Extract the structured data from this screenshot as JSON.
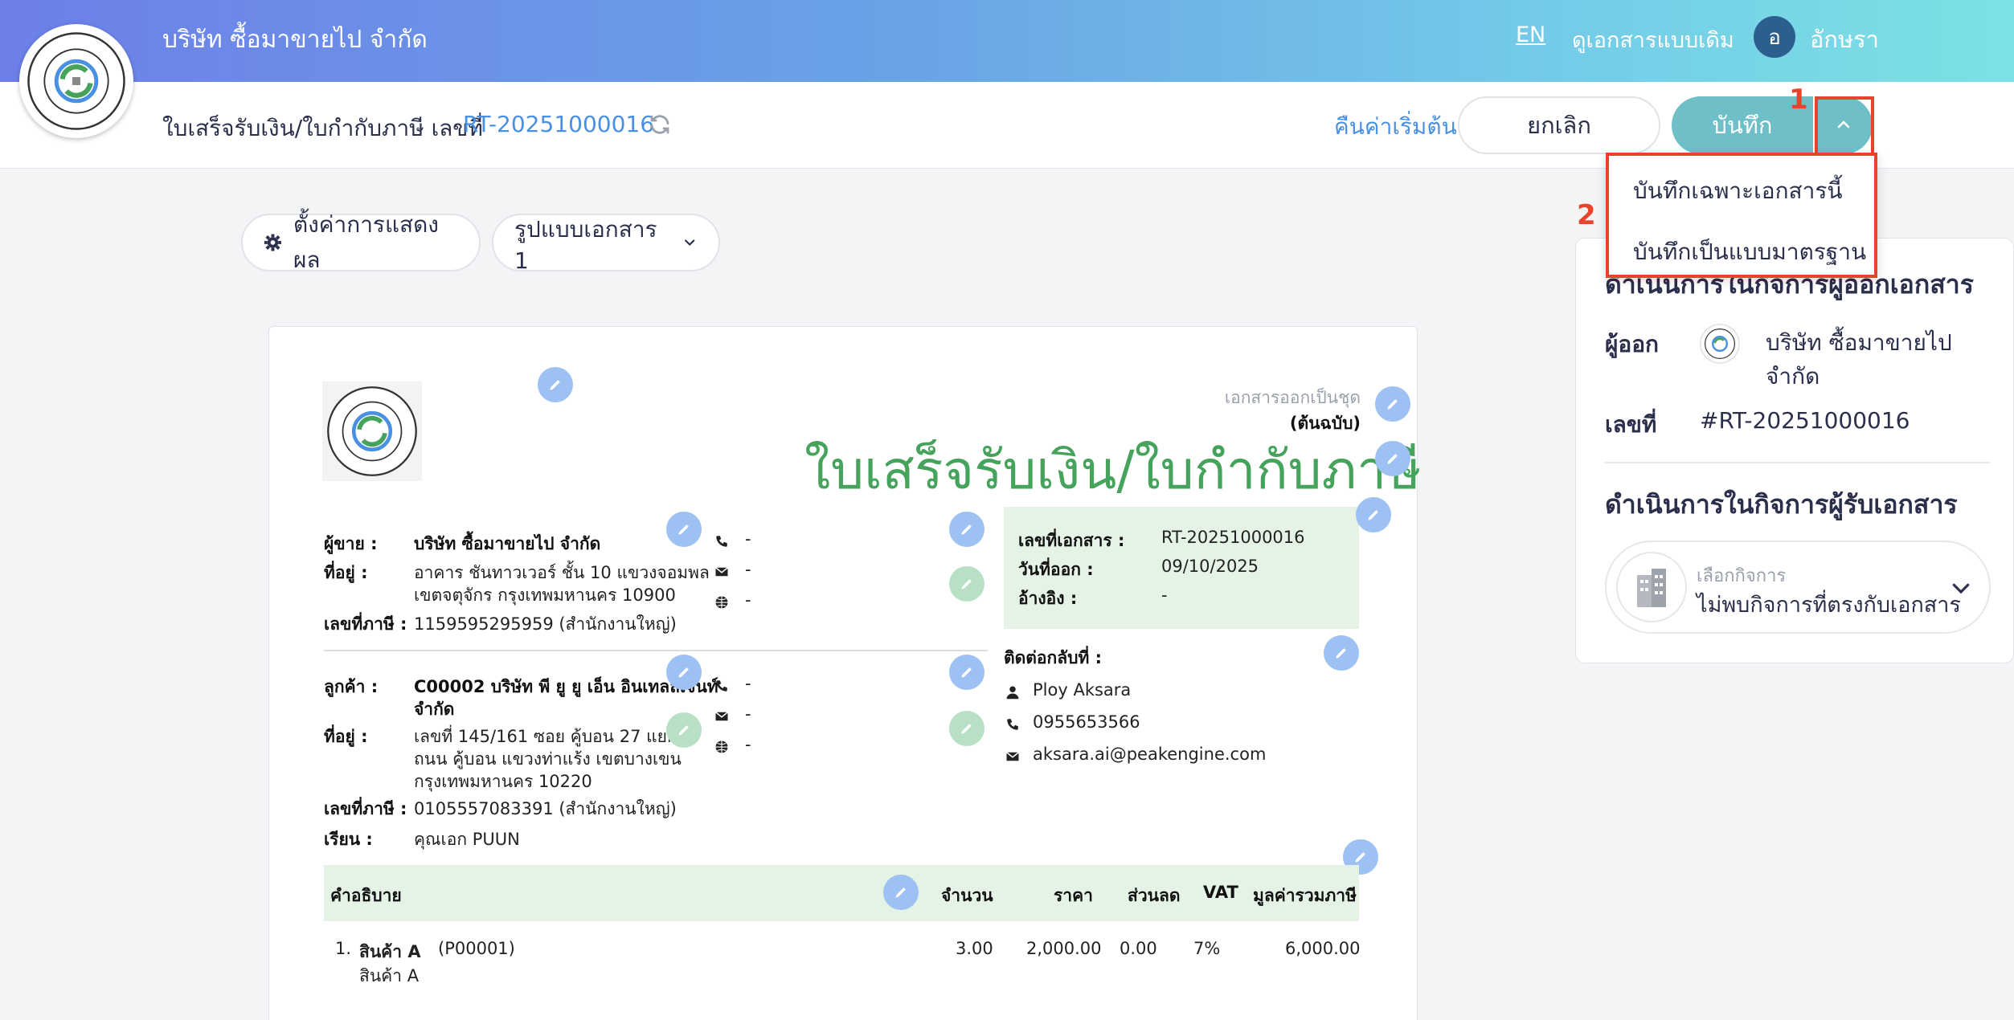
{
  "header": {
    "company_name": "บริษัท ซื้อมาขายไป จำกัด",
    "lang": "EN",
    "old_doc_view": "ดูเอกสารแบบเดิม",
    "avatar_initial": "อ",
    "user_name": "อักษรา"
  },
  "subheader": {
    "doc_type": "ใบเสร็จรับเงิน/ใบกำกับภาษี เลขที่",
    "doc_number": "RT-20251000016",
    "reset_label": "คืนค่าเริ่มต้น",
    "cancel_label": "ยกเลิก",
    "save_label": "บันทึก"
  },
  "save_menu": {
    "items": [
      "บันทึกเฉพาะเอกสารนี้",
      "บันทึกเป็นแบบมาตรฐาน"
    ]
  },
  "annotations": {
    "one": "1",
    "two": "2"
  },
  "toolbar": {
    "display_settings": "ตั้งค่าการแสดงผล",
    "template": "รูปแบบเอกสาร 1"
  },
  "document": {
    "issued_as_set": "เอกสารออกเป็นชุด",
    "original": "(ต้นฉบับ)",
    "title": "ใบเสร็จรับเงิน/ใบกำกับภาษี",
    "seller": {
      "label": "ผู้ขาย :",
      "name": "บริษัท ซื้อมาขายไป จำกัด",
      "address_label": "ที่อยู่ :",
      "address_1": "อาคาร ชันทาวเวอร์ ชั้น 10 แขวงจอมพล",
      "address_2": "เขตจตุจักร กรุงเทพมหานคร 10900",
      "tax_label": "เลขที่ภาษี :",
      "tax_id": "1159595295959 (สำนักงานใหญ่)",
      "phone": "-",
      "email": "-",
      "web": "-"
    },
    "customer": {
      "label": "ลูกค้า :",
      "name_1": "C00002 บริษัท พี ยู ยู เอ็น อินเทลลิเจนท์",
      "name_2": "จำกัด",
      "address_label": "ที่อยู่ :",
      "address_1": "เลขที่ 145/161    ซอย คู้บอน 27 แยก 7",
      "address_2": "ถนน คู้บอน  แขวงท่าแร้ง เขตบางเขน",
      "address_3": "กรุงเทพมหานคร 10220",
      "tax_label": "เลขที่ภาษี :",
      "tax_id": "0105557083391 (สำนักงานใหญ่)",
      "attn_label": "เรียน :",
      "attn": "คุณเอก PUUN",
      "phone": "-",
      "email": "-",
      "web": "-"
    },
    "info": {
      "doc_no_label": "เลขที่เอกสาร :",
      "doc_no": "RT-20251000016",
      "date_label": "วันที่ออก :",
      "date": "09/10/2025",
      "ref_label": "อ้างอิง :",
      "ref": "-"
    },
    "contact": {
      "label": "ติดต่อกลับที่ :",
      "name": "Ploy Aksara",
      "phone": "0955653566",
      "email": "aksara.ai@peakengine.com"
    },
    "table": {
      "headers": [
        "คำอธิบาย",
        "จำนวน",
        "ราคา",
        "ส่วนลด",
        "VAT",
        "มูลค่ารวมภาษี"
      ],
      "rows": [
        {
          "no": "1.",
          "name": "สินค้า A",
          "code": "(P00001)",
          "desc": "สินค้า A",
          "qty": "3.00",
          "price": "2,000.00",
          "discount": "0.00",
          "vat": "7%",
          "total": "6,000.00"
        }
      ]
    }
  },
  "right_panel": {
    "issuer_heading": "ดำเนินการในกิจการผู้ออกเอกสาร",
    "issuer_label": "ผู้ออก",
    "issuer_name_1": "บริษัท ซื้อมาขายไป",
    "issuer_name_2": "จำกัด",
    "number_label": "เลขที่",
    "number_value": "#RT-20251000016",
    "receiver_heading": "ดำเนินการในกิจการผู้รับเอกสาร",
    "select_label": "เลือกกิจการ",
    "select_value": "ไม่พบกิจการที่ตรงกับเอกสาร"
  },
  "colors": {
    "accent": "#4a90e2",
    "title_green": "#45a35b",
    "save": "#6fbfc9",
    "annotation": "#e8432c"
  }
}
